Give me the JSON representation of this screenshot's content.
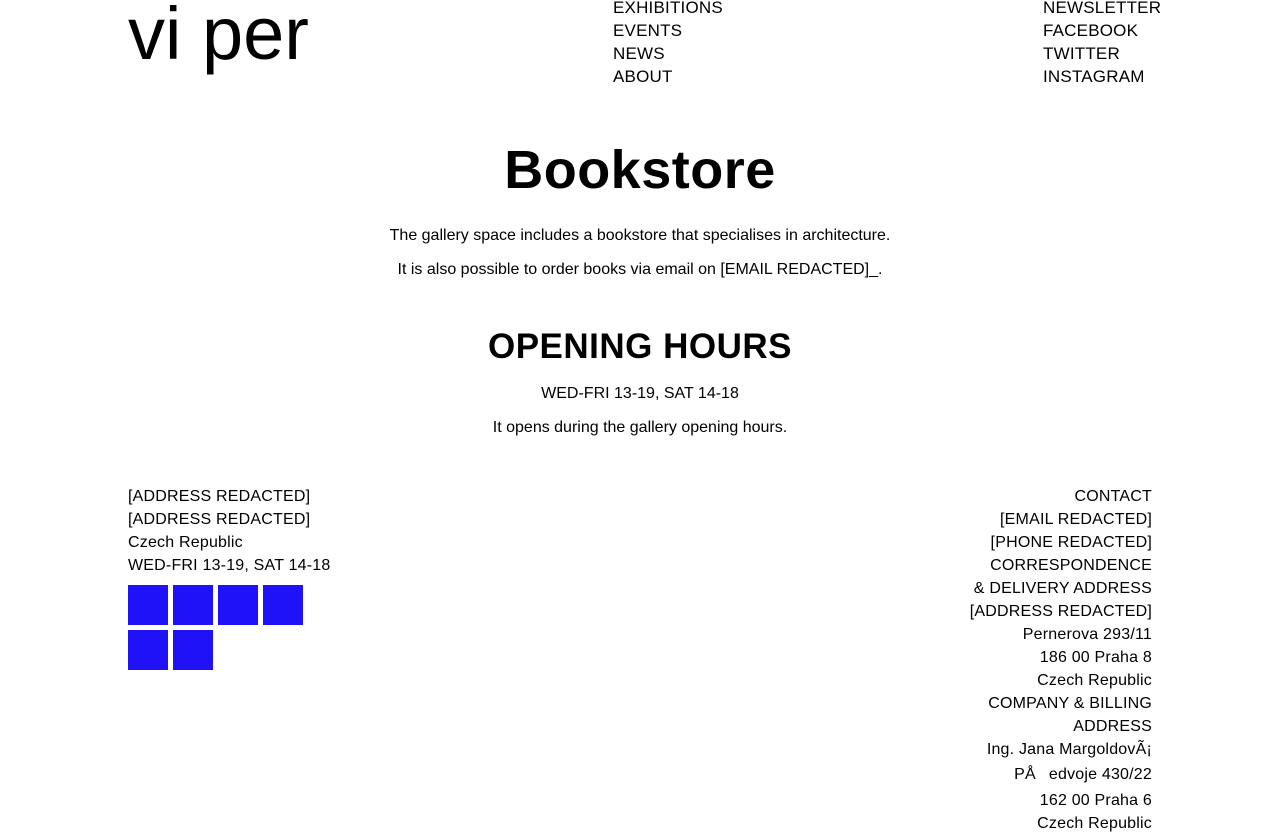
{
  "header": {
    "logo": "vi per",
    "nav_main": [
      "EXHIBITIONS",
      "EVENTS",
      "NEWS",
      "ABOUT"
    ],
    "nav_social": [
      "NEWSLETTER",
      "FACEBOOK",
      "TWITTER",
      "INSTAGRAM"
    ]
  },
  "main": {
    "title": "Bookstore",
    "paragraph_1": "The gallery space includes a bookstore that specialises in architecture.",
    "paragraph_2": "It is also possible to order books via email on [EMAIL REDACTED]_.",
    "hours_title": "OPENING HOURS",
    "hours": "WED-FRI 13-19, SAT 14-18",
    "hours_note": "It opens during the gallery opening hours."
  },
  "footer": {
    "left_lines": [
      "[ADDRESS REDACTED]",
      "[ADDRESS REDACTED]",
      "Czech Republic",
      "WED-FRI 13-19, SAT 14-18"
    ],
    "partner_squares_color": "#1f12f7",
    "partner_squares_count": 6,
    "right_lines": [
      "CONTACT",
      "[EMAIL REDACTED]",
      "[PHONE REDACTED]",
      "CORRESPONDENCE",
      "& DELIVERY ADDRESS",
      "[ADDRESS REDACTED]",
      "Pernerova 293/11",
      "186 00 Praha 8",
      "Czech Republic",
      "COMPANY & BILLING",
      "ADDRESS",
      "Ing. Jana MargoldovÃ¡",
      "PÅedvoje 430/22",
      "162 00 Praha 6",
      "Czech Republic"
    ]
  }
}
